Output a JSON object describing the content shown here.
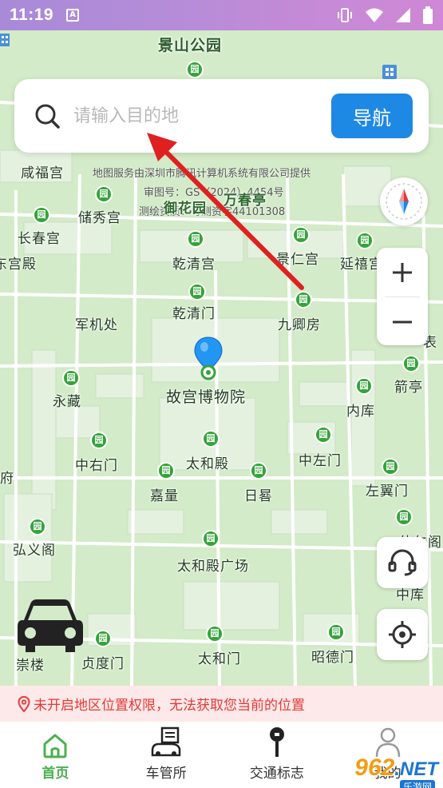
{
  "status_bar": {
    "time": "11:19",
    "app_badge": "A"
  },
  "search": {
    "placeholder": "请输入目的地",
    "nav_button": "导航"
  },
  "map": {
    "copyright_lines": [
      "地图服务由深圳市腾讯计算机系统有限公司提供",
      "审图号：GS（2024）4454号",
      "测绘资质：粤测资字44101308"
    ],
    "pois": [
      {
        "id": "jingshan",
        "label": "景山公园"
      },
      {
        "id": "xianfu",
        "label": "咸福宫"
      },
      {
        "id": "chuxiu",
        "label": "储秀宫"
      },
      {
        "id": "yuhua",
        "label": "御花园"
      },
      {
        "id": "wanchun",
        "label": "万春亭"
      },
      {
        "id": "changchun",
        "label": "长春宫"
      },
      {
        "id": "qianqing-gong",
        "label": "乾清宫"
      },
      {
        "id": "jingren",
        "label": "景仁宫"
      },
      {
        "id": "yanxi",
        "label": "延禧宫"
      },
      {
        "id": "dongdian",
        "label": "东宫殿"
      },
      {
        "id": "qianqing-men",
        "label": "乾清门"
      },
      {
        "id": "jiuqing",
        "label": "九卿房"
      },
      {
        "id": "junji",
        "label": "军机处"
      },
      {
        "id": "biao",
        "label": "表"
      },
      {
        "id": "gugong",
        "label": "故宫博物院"
      },
      {
        "id": "jianting",
        "label": "箭亭"
      },
      {
        "id": "yongzang",
        "label": "永藏"
      },
      {
        "id": "neiku",
        "label": "内库"
      },
      {
        "id": "zhongyou",
        "label": "中右门"
      },
      {
        "id": "taihe-dian",
        "label": "太和殿"
      },
      {
        "id": "zhongzuo",
        "label": "中左门"
      },
      {
        "id": "fu",
        "label": "府"
      },
      {
        "id": "jialiang",
        "label": "嘉量"
      },
      {
        "id": "rigui",
        "label": "日晷"
      },
      {
        "id": "zuoyi",
        "label": "左翼门"
      },
      {
        "id": "hongyi",
        "label": "弘义阁"
      },
      {
        "id": "taihe-guangchang",
        "label": "太和殿广场"
      },
      {
        "id": "weihe",
        "label": "体仁阁"
      },
      {
        "id": "zhongku",
        "label": "中库"
      },
      {
        "id": "chonglou",
        "label": "崇楼"
      },
      {
        "id": "zhendu",
        "label": "贞度门"
      },
      {
        "id": "taihe-men",
        "label": "太和门"
      },
      {
        "id": "zhaode",
        "label": "昭德门"
      }
    ],
    "park_icon_char": "园"
  },
  "warning": "未开启地区位置权限，无法获取您当前的位置",
  "tabs": [
    {
      "label": "首页",
      "icon": "home-icon",
      "active": true
    },
    {
      "label": "车管所",
      "icon": "vehicle-office-icon",
      "active": false
    },
    {
      "label": "交通标志",
      "icon": "traffic-sign-icon",
      "active": false
    },
    {
      "label": "我的",
      "icon": "user-icon",
      "active": false
    }
  ],
  "watermark": {
    "number": "962",
    "suffix": ".NET",
    "sub": "乐游网"
  },
  "colors": {
    "accent": "#1e88e5",
    "active_tab": "#4caf50",
    "warning": "#e53935",
    "park": "#35a33a"
  }
}
